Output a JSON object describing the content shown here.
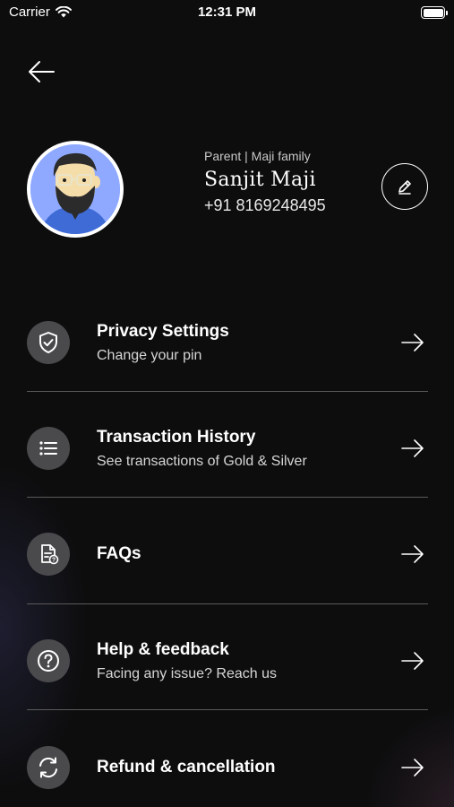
{
  "status_bar": {
    "carrier": "Carrier",
    "time": "12:31 PM",
    "icons": [
      "wifi-icon",
      "battery-icon"
    ]
  },
  "header": {
    "back_icon": "back-arrow-icon"
  },
  "profile": {
    "role": "Parent | Maji family",
    "name": "Sanjit Maji",
    "phone": "+91 8169248495",
    "edit_icon": "pencil-icon",
    "avatar_bg": "#8ea9ff"
  },
  "menu": {
    "items": [
      {
        "title": "Privacy Settings",
        "subtitle": "Change your pin",
        "icon": "shield-check-icon"
      },
      {
        "title": "Transaction History",
        "subtitle": "See transactions of Gold & Silver",
        "icon": "list-icon"
      },
      {
        "title": "FAQs",
        "subtitle": "",
        "icon": "document-question-icon"
      },
      {
        "title": "Help & feedback",
        "subtitle": "Facing any issue? Reach us",
        "icon": "question-circle-icon"
      },
      {
        "title": "Refund & cancellation",
        "subtitle": "",
        "icon": "refresh-icon"
      }
    ]
  },
  "colors": {
    "background": "#0d0d0e",
    "icon_circle": "#4a4a4d",
    "divider": "#5a5a5a",
    "text_primary": "#ffffff"
  }
}
